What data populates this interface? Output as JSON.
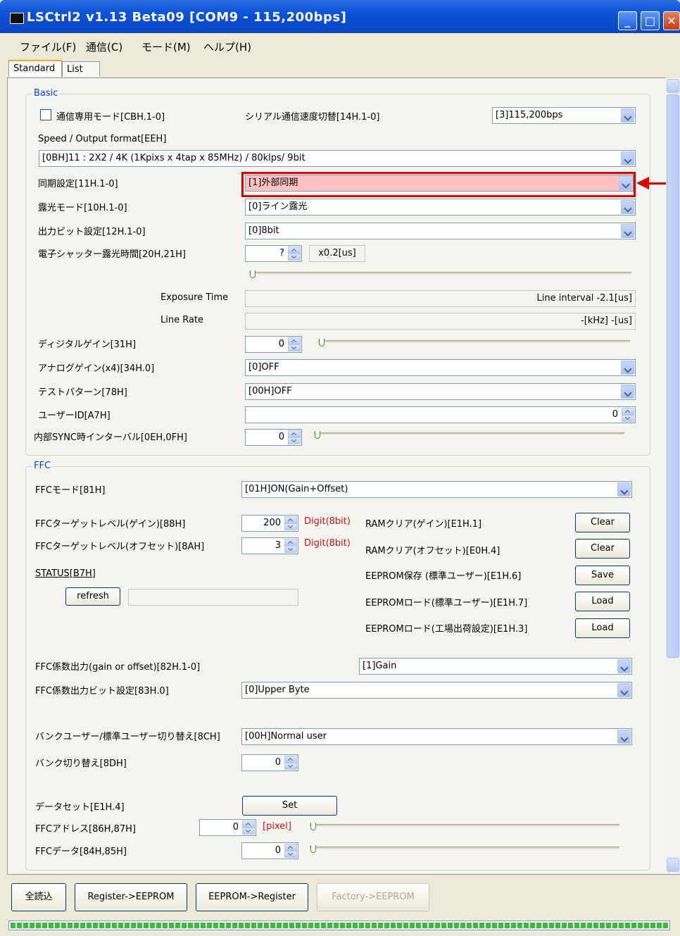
{
  "window": {
    "title": "LSCtrl2 v1.13 Beta09 [COM9 - 115,200bps]"
  },
  "menu": [
    "ファイル(F)",
    "通信(C)",
    "モード(M)",
    "ヘルプ(H)"
  ],
  "tabs": [
    "Standard",
    "List"
  ],
  "basic": {
    "title": "Basic",
    "comm_mode_label": "通信専用モード[CBH.1-0]",
    "serial_speed_label": "シリアル通信速度切替[14H.1-0]",
    "serial_speed_value": "[3]115,200bps",
    "speed_format_label": "Speed / Output format[EEH]",
    "speed_format_value": "[0BH]11 : 2X2 / 4K (1Kpixs x 4tap x 85MHz) / 80klps/ 9bit",
    "sync_label": "同期設定[11H.1-0]",
    "sync_value": "[1]外部同期",
    "exposure_mode_label": "露光モード[10H.1-0]",
    "exposure_mode_value": "[0]ライン露光",
    "output_bit_label": "出力ビット設定[12H.1-0]",
    "output_bit_value": "[0]8bit",
    "shutter_label": "電子シャッター露光時間[20H,21H]",
    "shutter_value": "?",
    "shutter_unit": "x0.2[us]",
    "exposure_time_label": "Exposure Time",
    "exposure_time_value": "Line interval -2.1[us]",
    "line_rate_label": "Line Rate",
    "line_rate_value": "-[kHz]  -[us]",
    "digital_gain_label": "ディジタルゲイン[31H]",
    "digital_gain_value": "0",
    "analog_gain_label": "アナログゲイン(x4)[34H.0]",
    "analog_gain_value": "[0]OFF",
    "test_pattern_label": "テストパターン[78H]",
    "test_pattern_value": "[00H]OFF",
    "user_id_label": "ユーザーID[A7H]",
    "user_id_value": "0",
    "sync_interval_label": "内部SYNC時インターバル[0EH,0FH]",
    "sync_interval_value": "0"
  },
  "ffc": {
    "title": "FFC",
    "mode_label": "FFCモード[81H]",
    "mode_value": "[01H]ON(Gain+Offset)",
    "target_gain_label": "FFCターゲットレベル(ゲイン)[88H]",
    "target_gain_value": "200",
    "target_gain_unit": "Digit(8bit)",
    "target_offset_label": "FFCターゲットレベル(オフセット)[8AH]",
    "target_offset_value": "3",
    "target_offset_unit": "Digit(8bit)",
    "ram_clear_gain_label": "RAMクリア(ゲイン)[E1H.1]",
    "ram_clear_offset_label": "RAMクリア(オフセット)[E0H.4]",
    "clear_label": "Clear",
    "status_label": "STATUS[B7H]",
    "refresh_label": "refresh",
    "eeprom_save_label": "EEPROM保存 (標準ユーザー)[E1H.6]",
    "save_label": "Save",
    "eeprom_load_user_label": "EEPROMロード(標準ユーザー)[E1H.7]",
    "eeprom_load_factory_label": "EEPROMロード(工場出荷設定)[E1H.3]",
    "load_label": "Load",
    "coef_output_label": "FFC係数出力(gain or offset)[82H.1-0]",
    "coef_output_value": "[1]Gain",
    "coef_bit_label": "FFC係数出力ビット設定[83H.0]",
    "coef_bit_value": "[0]Upper Byte",
    "bank_user_label": "バンクユーザー/標準ユーザー切り替え[8CH]",
    "bank_user_value": "[00H]Normal user",
    "bank_switch_label": "バンク切り替え[8DH]",
    "bank_switch_value": "0",
    "data_set_label": "データセット[E1H.4]",
    "set_label": "Set",
    "address_label": "FFCアドレス[86H,87H]",
    "address_value": "0",
    "address_unit": "[pixel]",
    "data_label": "FFCデータ[84H,85H]",
    "data_value": "0"
  },
  "bottom": {
    "read_all": "全読込",
    "reg_to_eeprom": "Register->EEPROM",
    "eeprom_to_reg": "EEPROM->Register",
    "factory_to_eeprom": "Factory->EEPROM"
  },
  "colors": {
    "highlight": "#e00000",
    "sync_bg": "#ffc0c0",
    "group_title": "#0046d5"
  }
}
